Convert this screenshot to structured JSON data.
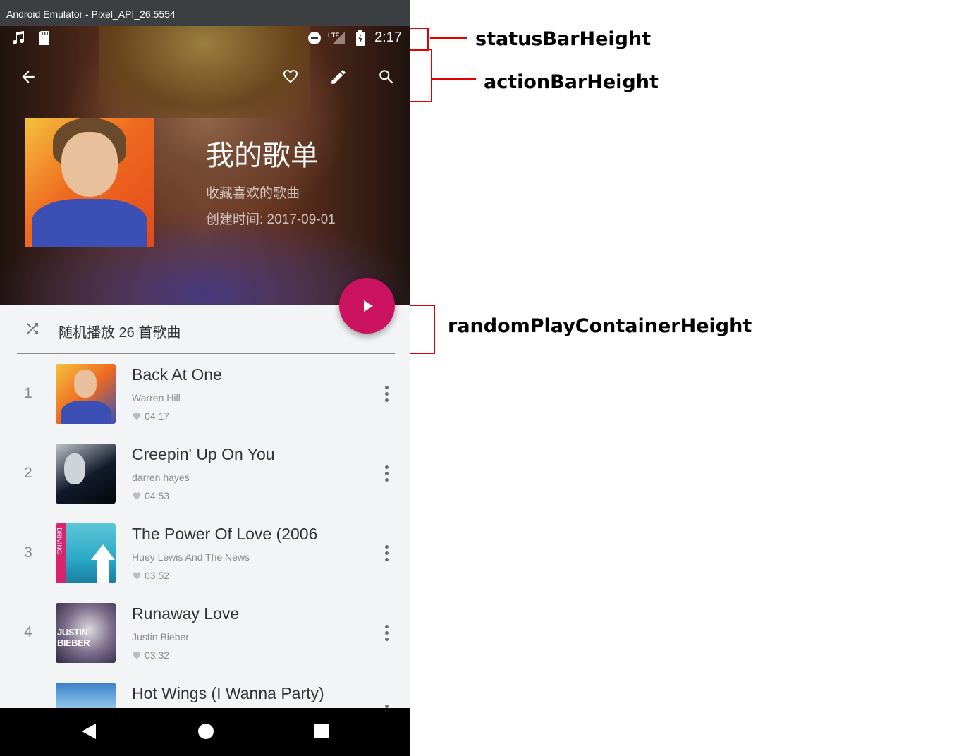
{
  "emulator": {
    "title": "Android Emulator - Pixel_API_26:5554"
  },
  "status_bar": {
    "left_icons": [
      "music-note-icon",
      "sd-card-icon"
    ],
    "right_icons": [
      "do-not-disturb-icon",
      "lte-signal-icon",
      "battery-charging-icon"
    ],
    "network_label": "LTE",
    "time": "2:17"
  },
  "action_bar": {
    "buttons": [
      "back-arrow-icon",
      "heart-icon",
      "edit-pencil-icon",
      "search-icon"
    ]
  },
  "playlist": {
    "title": "我的歌单",
    "description": "收藏喜欢的歌曲",
    "created": "创建时间: 2017-09-01"
  },
  "random_play": {
    "label": "随机播放 26 首歌曲"
  },
  "songs": [
    {
      "number": "1",
      "title": "Back At One",
      "artist": "Warren Hill",
      "duration": "04:17"
    },
    {
      "number": "2",
      "title": "Creepin' Up On You",
      "artist": "darren hayes",
      "duration": "04:53"
    },
    {
      "number": "3",
      "title": "The Power Of Love (2006",
      "artist": "Huey Lewis And The News",
      "duration": "03:52"
    },
    {
      "number": "4",
      "title": "Runaway Love",
      "artist": "Justin Bieber",
      "duration": "03:32"
    },
    {
      "number": "",
      "title": "Hot Wings (I Wanna Party)",
      "artist": "",
      "duration": ""
    }
  ],
  "album_art_text": {
    "song3": "DRIVING",
    "song4": "JUSTIN BIEBER"
  },
  "annotations": {
    "status_bar_height": "statusBarHeight",
    "action_bar_height": "actionBarHeight",
    "random_play_container_height": "randomPlayContainerHeight"
  },
  "colors": {
    "fab": "#cc1360",
    "annotation_red": "#e20000",
    "list_background": "#f3f4f6"
  }
}
